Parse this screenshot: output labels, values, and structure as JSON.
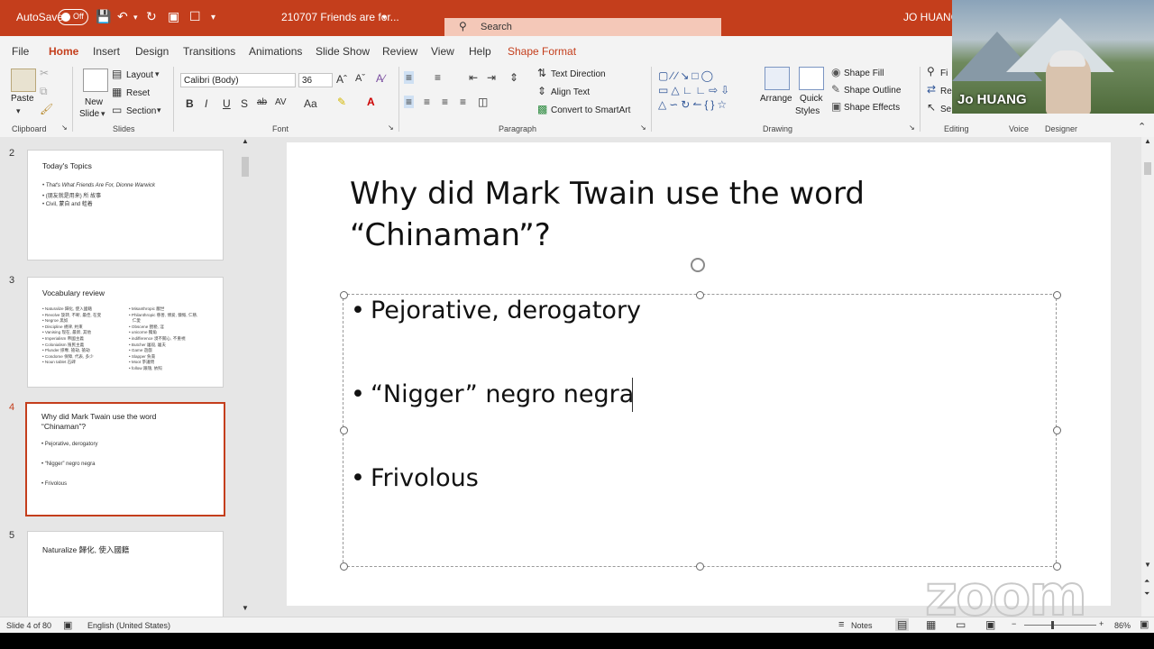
{
  "titlebar": {
    "autosave_label": "AutoSave",
    "autosave_state": "Off",
    "doc_title": "210707 Friends are for...",
    "search_placeholder": "Search",
    "user": "JO HUANG"
  },
  "tabs": [
    "File",
    "Home",
    "Insert",
    "Design",
    "Transitions",
    "Animations",
    "Slide Show",
    "Review",
    "View",
    "Help",
    "Shape Format"
  ],
  "ribbon": {
    "clipboard": {
      "paste": "Paste",
      "group": "Clipboard"
    },
    "slides": {
      "new_slide_1": "New",
      "new_slide_2": "Slide",
      "layout": "Layout",
      "reset": "Reset",
      "section": "Section",
      "group": "Slides"
    },
    "font": {
      "font_name": "Calibri (Body)",
      "font_size": "36",
      "group": "Font"
    },
    "paragraph": {
      "text_direction": "Text Direction",
      "align_text": "Align Text",
      "convert": "Convert to SmartArt",
      "group": "Paragraph"
    },
    "drawing": {
      "arrange": "Arrange",
      "quick_1": "Quick",
      "quick_2": "Styles",
      "shape_fill": "Shape Fill",
      "shape_outline": "Shape Outline",
      "shape_effects": "Shape Effects",
      "group": "Drawing"
    },
    "editing": {
      "group": "Editing",
      "find": "Fi",
      "replace": "Re",
      "select": "Se"
    },
    "voice": "Voice",
    "designer": "Designer"
  },
  "video": {
    "name": "Jo HUANG"
  },
  "thumbnails": [
    {
      "num": "2",
      "title": "Today's Topics",
      "lines": [
        "• That's What Friends Are For, Dionne Warwick",
        "• (朋友就是用来) 所 故事",
        "• Civil, 蒙自 and 蛙着"
      ]
    },
    {
      "num": "3",
      "title": "Vocabulary review",
      "col1": "• Naturalize 歸化, 使入國籍\n• Revolve 旋转, 不断, 最佳, 在变\n• Negroe 黑奴\n• Discipline 規律, 約束\n• Vanising 现在, 最新, 其他\n• Imperialism 帝國主義\n• Colonialism 殖民主義\n• Plunder 掠奪, 搶劫, 搶劫\n• Condome 保障, 代表, 多少\n• Noun tablet 石碑",
      "col2": "• Misanthropic 厭世\n• Philanthropic 慈善, 博爱, 慷慨, 仁慈,\n   仁愛\n• Obscene 猥褻, 淫\n• unicorne 獨角\n• indifference 漠不關心, 不重視\n• Butcher 屠殺, 屠夫\n• Game 遊戲\n• Slapper 負責\n• Moot 爭議問\n• follow 跟隨, 依照"
    },
    {
      "num": "4",
      "title_1": "Why did Mark Twain use the word",
      "title_2": "“Chinaman”?",
      "lines": [
        "• Pejorative, derogatory",
        "• “Nigger” negro negra",
        "• Frivolous"
      ]
    },
    {
      "num": "5",
      "title": "Naturalize 歸化, 使入國籍"
    }
  ],
  "slide": {
    "title_1": "Why did Mark Twain use the word",
    "title_2": "“Chinaman”?",
    "bullets": [
      "Pejorative, derogatory",
      "“Nigger” negro negra",
      "Frivolous"
    ]
  },
  "status": {
    "slide_of": "Slide 4 of 80",
    "language": "English (United States)",
    "notes": "Notes",
    "zoom": "86%"
  },
  "watermark": "zoom"
}
